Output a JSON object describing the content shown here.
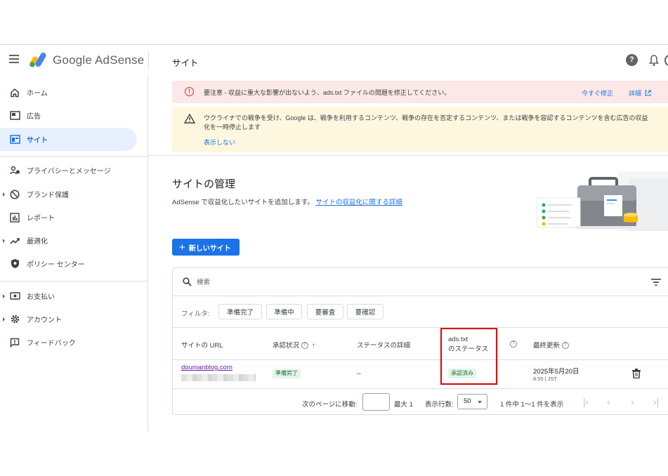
{
  "header": {
    "brand": "Google AdSense",
    "title": "サイト",
    "help_icon": "?"
  },
  "sidebar": {
    "items": [
      {
        "label": "ホーム",
        "icon": "home-icon"
      },
      {
        "label": "広告",
        "icon": "ads-icon"
      },
      {
        "label": "サイト",
        "icon": "sites-icon",
        "active": true
      },
      {
        "label": "プライバシーとメッセージ",
        "icon": "privacy-icon"
      },
      {
        "label": "ブランド保護",
        "icon": "block-icon"
      },
      {
        "label": "レポート",
        "icon": "report-icon"
      },
      {
        "label": "最適化",
        "icon": "trend-icon"
      },
      {
        "label": "ポリシー センター",
        "icon": "policy-icon"
      },
      {
        "label": "お支払い",
        "icon": "payment-icon"
      },
      {
        "label": "アカウント",
        "icon": "gear-icon"
      },
      {
        "label": "フィードバック",
        "icon": "feedback-icon"
      }
    ]
  },
  "alerts": {
    "error": {
      "text": "要注意 - 収益に重大な影響が出ないよう、ads.txt ファイルの問題を修正してください。",
      "fix_link": "今すぐ修正",
      "details_link": "詳細"
    },
    "warning": {
      "text": "ウクライナでの戦争を受け、Google は、戦争を利用するコンテンツ、戦争の存在を否定するコンテンツ、または戦争を容認するコンテンツを含む広告の収益化を一時停止します",
      "dismiss_link": "表示しない"
    }
  },
  "main": {
    "title": "サイトの管理",
    "subtitle": "AdSense で収益化したいサイトを追加します。",
    "subtitle_link": "サイトの収益化に関する詳細",
    "new_site_button": "新しいサイト"
  },
  "table": {
    "search_placeholder": "検索",
    "filter_label": "フィルタ:",
    "filters": [
      "準備完了",
      "準備中",
      "要審査",
      "要確認"
    ],
    "headers": {
      "url": "サイトの URL",
      "approval": "承認状況",
      "status_detail": "ステータスの詳細",
      "ads_txt_line1": "ads.txt",
      "ads_txt_line2": "のステータス",
      "updated": "最終更新"
    },
    "rows": [
      {
        "url": "doumanblog.com",
        "approval": "準備完了",
        "status_detail": "–",
        "ads_txt": "承認済み",
        "updated_date": "2025年5月20日",
        "updated_time": "8:55 | JST"
      }
    ],
    "pager": {
      "goto_label": "次のページに移動:",
      "max_label": "最大 1",
      "rows_label": "表示行数:",
      "rows_value": "50",
      "range": "1 件中 1〜1 件を表示"
    }
  },
  "colors": {
    "accent": "#1a73e8",
    "error_bg": "#fce8e6",
    "warning_bg": "#fef7e0",
    "success": "#137333",
    "highlight_box": "#e00000"
  }
}
